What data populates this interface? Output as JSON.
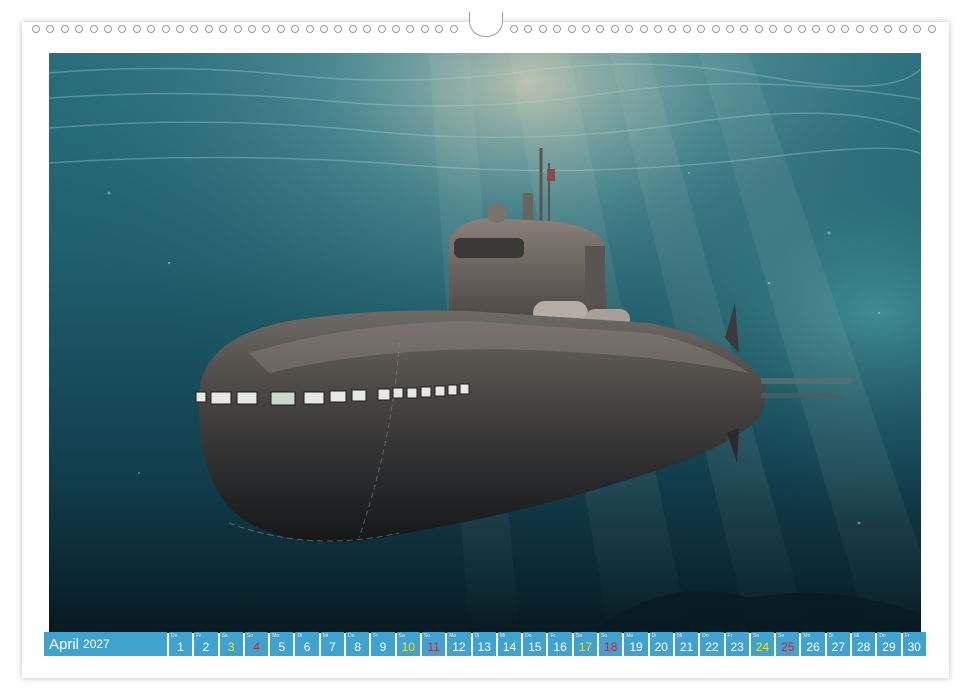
{
  "calendar": {
    "month": "April",
    "year": "2027",
    "days": [
      {
        "wd": "Do",
        "num": "1",
        "type": "weekday"
      },
      {
        "wd": "Fr",
        "num": "2",
        "type": "weekday"
      },
      {
        "wd": "Sa",
        "num": "3",
        "type": "sat"
      },
      {
        "wd": "So",
        "num": "4",
        "type": "sun"
      },
      {
        "wd": "Mo",
        "num": "5",
        "type": "weekday"
      },
      {
        "wd": "Di",
        "num": "6",
        "type": "weekday"
      },
      {
        "wd": "Mi",
        "num": "7",
        "type": "weekday"
      },
      {
        "wd": "Do",
        "num": "8",
        "type": "weekday"
      },
      {
        "wd": "Fr",
        "num": "9",
        "type": "weekday"
      },
      {
        "wd": "Sa",
        "num": "10",
        "type": "sat"
      },
      {
        "wd": "So",
        "num": "11",
        "type": "sun"
      },
      {
        "wd": "Mo",
        "num": "12",
        "type": "weekday"
      },
      {
        "wd": "Di",
        "num": "13",
        "type": "weekday"
      },
      {
        "wd": "Mi",
        "num": "14",
        "type": "weekday"
      },
      {
        "wd": "Do",
        "num": "15",
        "type": "weekday"
      },
      {
        "wd": "Fr",
        "num": "16",
        "type": "weekday"
      },
      {
        "wd": "Sa",
        "num": "17",
        "type": "sat"
      },
      {
        "wd": "So",
        "num": "18",
        "type": "sun"
      },
      {
        "wd": "Mo",
        "num": "19",
        "type": "weekday"
      },
      {
        "wd": "Di",
        "num": "20",
        "type": "weekday"
      },
      {
        "wd": "Mi",
        "num": "21",
        "type": "weekday"
      },
      {
        "wd": "Do",
        "num": "22",
        "type": "weekday"
      },
      {
        "wd": "Fr",
        "num": "23",
        "type": "weekday"
      },
      {
        "wd": "Sa",
        "num": "24",
        "type": "sat"
      },
      {
        "wd": "So",
        "num": "25",
        "type": "sun"
      },
      {
        "wd": "Mo",
        "num": "26",
        "type": "weekday"
      },
      {
        "wd": "Di",
        "num": "27",
        "type": "weekday"
      },
      {
        "wd": "Mi",
        "num": "28",
        "type": "weekday"
      },
      {
        "wd": "Do",
        "num": "29",
        "type": "weekday"
      },
      {
        "wd": "Fr",
        "num": "30",
        "type": "weekday"
      }
    ]
  },
  "colors": {
    "bar": "#3fa2cf",
    "saturday": "#f6e21a",
    "sunday": "#d4212a",
    "water_deep": "#0b2a3a",
    "water_light": "#3f8f9a"
  },
  "image": {
    "subject": "submarine-underwater-photo"
  }
}
